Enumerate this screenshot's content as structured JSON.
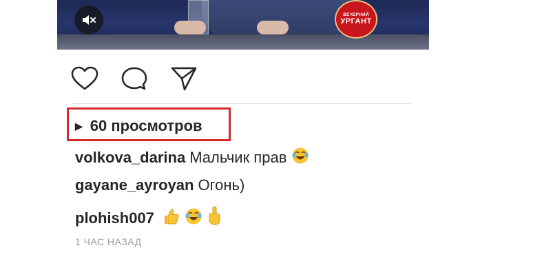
{
  "video": {
    "logo_small": "ВЕЧЕРНИЙ",
    "logo_big": "УРГАНТ",
    "mute_icon": "muted-speaker-icon"
  },
  "actions": {
    "icons": [
      "heart-icon",
      "comment-bubble-icon",
      "send-paper-plane-icon"
    ]
  },
  "views": {
    "play_glyph": "▶",
    "label": "60 просмотров"
  },
  "comments": [
    {
      "user": "volkova_darina",
      "text": "Мальчик прав",
      "emoji": [
        "face-with-tears-of-joy"
      ]
    },
    {
      "user": "gayane_ayroyan",
      "text": "Огонь)",
      "emoji": []
    },
    {
      "user": "plohish007",
      "text": "",
      "emoji": [
        "thumbs-up",
        "face-with-tears-of-joy",
        "index-pointing-up"
      ]
    }
  ],
  "timestamp": "1 ЧАС НАЗАД",
  "colors": {
    "highlight_box": "#d52b2f",
    "text": "#262626",
    "muted": "#999999"
  }
}
